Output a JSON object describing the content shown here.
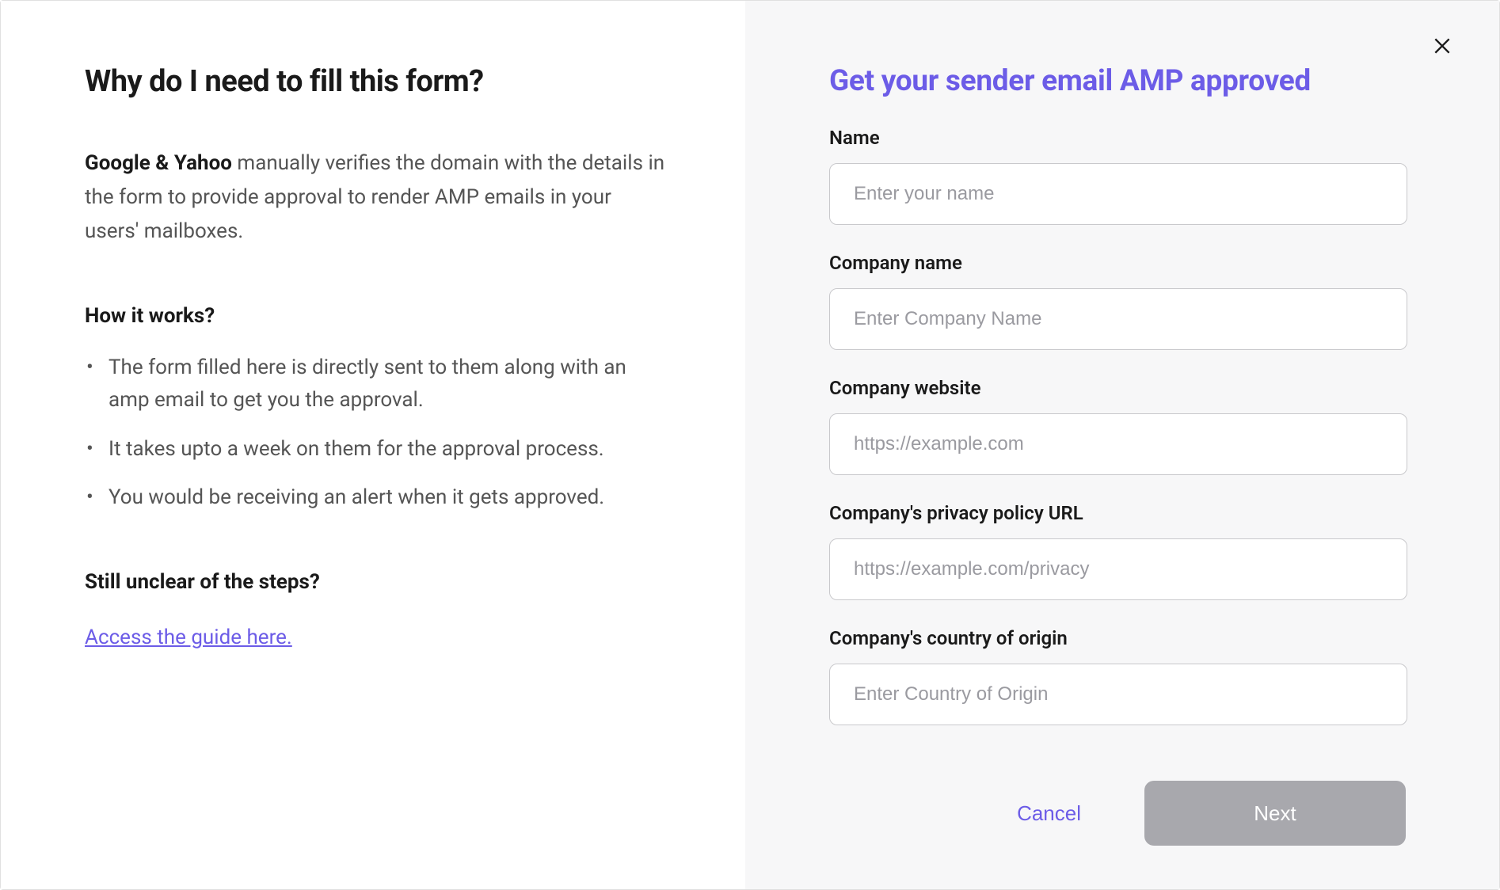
{
  "left": {
    "title": "Why do I need to fill this form?",
    "description_strong": "Google & Yahoo",
    "description_rest": " manually verifies the domain with the details in the form to provide approval to render AMP emails in your users' mailboxes.",
    "how_it_works_heading": "How it works?",
    "bullets": [
      "The form filled here is directly sent to them along with an amp email to get you the approval.",
      "It takes upto a week on them for the approval process.",
      "You would be receiving an alert when it gets approved."
    ],
    "still_unclear_heading": "Still unclear of the steps?",
    "guide_link": "Access the guide here."
  },
  "right": {
    "title": "Get your sender email AMP approved",
    "fields": {
      "name": {
        "label": "Name",
        "placeholder": "Enter your name",
        "value": ""
      },
      "company_name": {
        "label": "Company name",
        "placeholder": "Enter Company Name",
        "value": ""
      },
      "company_website": {
        "label": "Company website",
        "placeholder": "https://example.com",
        "value": ""
      },
      "privacy_url": {
        "label": "Company's privacy policy URL",
        "placeholder": "https://example.com/privacy",
        "value": ""
      },
      "country": {
        "label": "Company's country of origin",
        "placeholder": "Enter Country of Origin",
        "value": ""
      }
    },
    "buttons": {
      "cancel": "Cancel",
      "next": "Next"
    }
  }
}
